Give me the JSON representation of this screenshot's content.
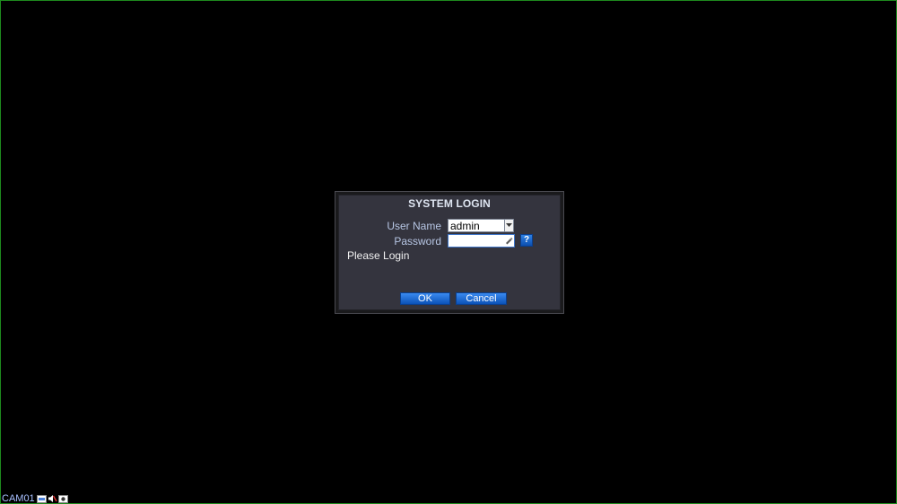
{
  "dialog": {
    "title": "SYSTEM LOGIN",
    "user_label": "User Name",
    "user_value": "admin",
    "password_label": "Password",
    "password_value": "",
    "help_label": "?",
    "status": "Please Login",
    "ok_label": "OK",
    "cancel_label": "Cancel"
  },
  "camera_bar": {
    "label": "CAM01",
    "icons": [
      "record-icon",
      "speaker-mute-icon",
      "motion-icon"
    ]
  },
  "colors": {
    "background": "#000000",
    "dialog_bg": "#34343e",
    "button_blue": "#0b52b8",
    "screen_border": "#1e8a1e",
    "label_text": "#b7c6e4"
  }
}
